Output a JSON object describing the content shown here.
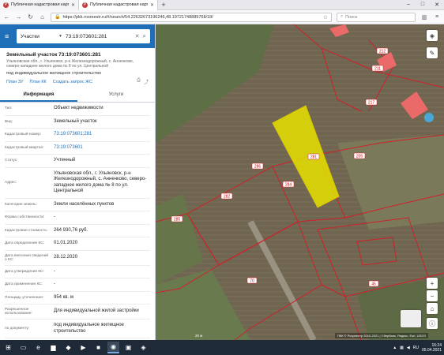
{
  "browser": {
    "tab_title": "Публичная кадастровая карта",
    "url": "https://pkk.rosreestr.ru/#/search/54.22632673196246,48.19721748889768/18/",
    "search_placeholder": "Поиск"
  },
  "panel": {
    "search": {
      "type_label": "Участки",
      "value": "73:19:073601:281"
    },
    "title": "Земельный участок 73:19:073601:281",
    "address_short": "Ульяновская обл., г. Ульяновск, р-н Железнодорожный, с. Анненково, северо-западнее жилого дома № 8 по ул. Центральной",
    "purpose": "под индивидуальное жилищное строительство",
    "links": [
      "План ЗУ",
      "План КК",
      "Создать запрос ЖС"
    ],
    "tabs": [
      "Информация",
      "Услуги"
    ],
    "rows": [
      {
        "key": "Тип:",
        "value": "Объект недвижимости"
      },
      {
        "key": "Вид:",
        "value": "Земельный участок"
      },
      {
        "key": "Кадастровый номер:",
        "value": "73:19:073601:281"
      },
      {
        "key": "Кадастровый квартал:",
        "value": "73:19:073601"
      },
      {
        "key": "Статус:",
        "value": "Учтенный"
      },
      {
        "key": "Адрес:",
        "value": "Ульяновская обл., г. Ульяновск, р-н Железнодорожный, с. Анненково, северо-западнее жилого дома № 8 по ул. Центральной"
      },
      {
        "key": "Категория земель:",
        "value": "Земли населённых пунктов"
      },
      {
        "key": "Форма собственности:",
        "value": "-"
      },
      {
        "key": "Кадастровая стоимость:",
        "value": "264 930,76 руб."
      },
      {
        "key": "Дата определения КС:",
        "value": "01.01.2020"
      },
      {
        "key": "Дата внесения сведений о КС:",
        "value": "28.12.2020"
      },
      {
        "key": "Дата утверждения КС:",
        "value": "-"
      },
      {
        "key": "Дата применения КС:",
        "value": "-"
      },
      {
        "key": "Площадь уточненная:",
        "value": "954 кв. м"
      },
      {
        "key": "Разрешенное использование:",
        "value": "Для индивидуальной жилой застройки"
      },
      {
        "key": "по документу:",
        "value": "под индивидуальное жилищное строительство"
      }
    ]
  },
  "map": {
    "parcel_labels": [
      "281",
      "286",
      "284",
      "282",
      "285",
      "212",
      "211",
      "70",
      "45",
      "205",
      "217"
    ],
    "scale": "20 м",
    "attribution": "ПКК © Росреестр 2010-2021 | Сбербанк, Яндекс, Esri, USGS",
    "zoom_in": "+",
    "zoom_out": "−",
    "colors": {
      "highlight": "#e6e000",
      "boundary": "#d21f2a",
      "building": "#ea6a6a"
    }
  },
  "taskbar": {
    "lang": "RU",
    "time": "16:24",
    "date": "05.04.2021"
  }
}
